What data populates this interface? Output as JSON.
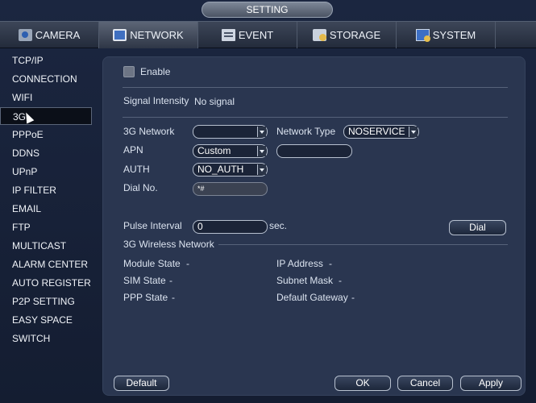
{
  "window": {
    "title": "SETTING"
  },
  "tabs": [
    {
      "label": "CAMERA",
      "icon": "camera-icon",
      "active": false
    },
    {
      "label": "NETWORK",
      "icon": "network-icon",
      "active": true
    },
    {
      "label": "EVENT",
      "icon": "event-icon",
      "active": false
    },
    {
      "label": "STORAGE",
      "icon": "storage-icon",
      "active": false
    },
    {
      "label": "SYSTEM",
      "icon": "system-icon",
      "active": false
    }
  ],
  "sidebar": {
    "items": [
      {
        "label": "TCP/IP"
      },
      {
        "label": "CONNECTION"
      },
      {
        "label": "WIFI"
      },
      {
        "label": "3G",
        "active": true
      },
      {
        "label": "PPPoE"
      },
      {
        "label": "DDNS"
      },
      {
        "label": "UPnP"
      },
      {
        "label": "IP FILTER"
      },
      {
        "label": "EMAIL"
      },
      {
        "label": "FTP"
      },
      {
        "label": "MULTICAST"
      },
      {
        "label": "ALARM CENTER"
      },
      {
        "label": "AUTO REGISTER"
      },
      {
        "label": "P2P SETTING"
      },
      {
        "label": "EASY SPACE"
      },
      {
        "label": "SWITCH"
      }
    ]
  },
  "form": {
    "enable_label": "Enable",
    "enable_checked": false,
    "signal_label": "Signal Intensity",
    "signal_value": "No signal",
    "network_label": "3G Network",
    "network_value": "",
    "network_type_label": "Network Type",
    "network_type_value": "NOSERVICE",
    "apn_label": "APN",
    "apn_value": "Custom",
    "apn_custom_value": "",
    "auth_label": "AUTH",
    "auth_value": "NO_AUTH",
    "dial_no_label": "Dial No.",
    "dial_no_value": "*#",
    "pulse_label": "Pulse Interval",
    "pulse_value": "0",
    "pulse_unit": "sec.",
    "dial_button": "Dial"
  },
  "wireless": {
    "section_title": "3G Wireless Network",
    "module_state_label": "Module State",
    "module_state_value": "-",
    "sim_state_label": "SIM State",
    "sim_state_value": "-",
    "ppp_state_label": "PPP State",
    "ppp_state_value": "-",
    "ip_label": "IP Address",
    "ip_value": "-",
    "subnet_label": "Subnet Mask",
    "subnet_value": "-",
    "gateway_label": "Default Gateway",
    "gateway_value": "-"
  },
  "footer": {
    "default_button": "Default",
    "ok_button": "OK",
    "cancel_button": "Cancel",
    "apply_button": "Apply"
  }
}
